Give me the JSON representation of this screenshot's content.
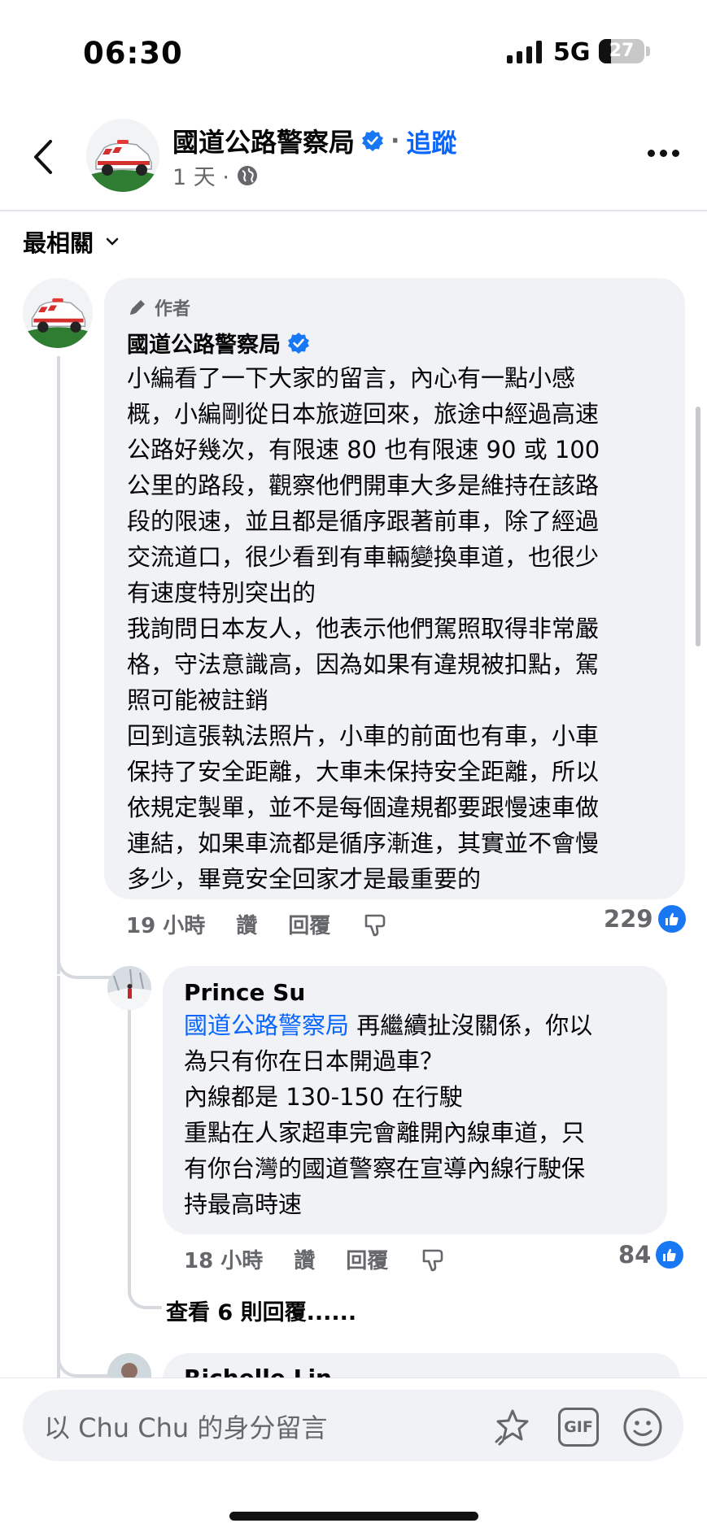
{
  "status_bar": {
    "time": "06:30",
    "network": "5G",
    "battery": "27",
    "battery_percent": 27
  },
  "header": {
    "page_name": "國道公路警察局",
    "separator": "·",
    "follow_label": "追蹤",
    "meta": "1 天 ·"
  },
  "sort": {
    "label": "最相關"
  },
  "comments": [
    {
      "author_tag": "作者",
      "name": "國道公路警察局",
      "text": "小編看了一下大家的留言，內心有一點小感\n概，小編剛從日本旅遊回來，旅途中經過高速\n公路好幾次，有限速 80 也有限速 90 或 100\n公里的路段，觀察他們開車大多是維持在該路\n段的限速，並且都是循序跟著前車，除了經過\n交流道口，很少看到有車輛變換車道，也很少\n有速度特別突出的\n我詢問日本友人，他表示他們駕照取得非常嚴\n格，守法意識高，因為如果有違規被扣點，駕\n照可能被註銷\n回到這張執法照片，小車的前面也有車，小車\n保持了安全距離，大車未保持安全距離，所以\n依規定製單，並不是每個違規都要跟慢速車做\n連結，如果車流都是循序漸進，其實並不會慢\n多少，畢竟安全回家才是最重要的",
      "time": "19 小時",
      "like_label": "讚",
      "reply_label": "回覆",
      "likes": "229"
    },
    {
      "name": "Prince Su",
      "mention": "國道公路警察局",
      "text_first": " 再繼續扯沒關係，你以",
      "text": "為只有你在日本開過車？\n內線都是 130-150 在行駛\n重點在人家超車完會離開內線車道，只\n有你台灣的國道警察在宣導內線行駛保\n持最高時速",
      "time": "18 小時",
      "like_label": "讚",
      "reply_label": "回覆",
      "likes": "84"
    }
  ],
  "view_replies": "查看 6 則回覆......",
  "partial_name": "Richelle Lin",
  "composer": {
    "placeholder": "以 Chu Chu 的身分留言",
    "gif_label": "GIF"
  },
  "colors": {
    "accent": "#0866ff",
    "like": "#1877f2",
    "bubble": "#f0f2f5",
    "muted": "#65676b"
  }
}
